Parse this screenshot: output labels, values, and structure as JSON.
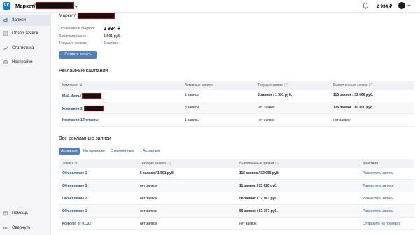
{
  "header": {
    "logo": "VK",
    "title": "Маркет/",
    "balance": "2 934 ₽",
    "icons": [
      "bell-icon",
      "avatar"
    ]
  },
  "sidebar": {
    "items": [
      {
        "label": "Записи",
        "icon": "megaphone-icon",
        "active": true
      },
      {
        "label": "Обзор заявок",
        "icon": "list-icon"
      },
      {
        "label": "Статистика",
        "icon": "chart-icon"
      },
      {
        "label": "Настройки",
        "icon": "gear-icon"
      }
    ],
    "bottom": [
      {
        "label": "Помощь",
        "icon": "help-icon"
      },
      {
        "label": "Свернуть",
        "icon": "collapse-icon"
      }
    ]
  },
  "main": {
    "breadcrumb": "Маркет/",
    "info": [
      {
        "label": "Оставшийся бюджет:",
        "value": "2 934 ₽"
      },
      {
        "label": "Заблокировано:",
        "value": "1 591 руб."
      },
      {
        "label": "Текущие заявки:",
        "value": "5 заявок"
      }
    ],
    "create_button": "Создать запись",
    "campaigns": {
      "title": "Рекламные кампании",
      "headers": [
        "Кампания ⇅",
        "Активные записи",
        "Текущие заявки",
        "Выполненные заявки"
      ],
      "header_help": "[?]",
      "rows": [
        {
          "name": "Май-Июль/",
          "active": "1 запись",
          "current": "5 заявок / 1 591 руб.",
          "done": "115 заявок / 32 066 руб."
        },
        {
          "name": "Компания 2/",
          "active": "3 записи",
          "current": "нет заявок",
          "done": "125 заявок / 80 000 руб."
        },
        {
          "name": "Компания 1/Репосты",
          "active": "1 запись",
          "current": "нет заявок",
          "done": "нет заявок"
        }
      ]
    },
    "ads": {
      "title": "Все рекламные записи",
      "tabs": [
        "Активные",
        "На проверке",
        "Отклонённые",
        "Архивные"
      ],
      "headers": [
        "Запись ⇅",
        "Текущие заявки",
        "Выполненные заявки",
        "Действия"
      ],
      "header_help": "[?]",
      "rows": [
        {
          "name": "Объявление 1",
          "current": "5 заявок / 1 591 руб.",
          "done": "115 заявок / 32 066 руб.",
          "action": "Разместить запись"
        },
        {
          "name": "Объявление 3",
          "current": "нет заявок",
          "done": "11 заявок / 15 620 руб.",
          "action": "Разместить запись"
        },
        {
          "name": "Объявление 2",
          "current": "нет заявок",
          "done": "58 заявок / 12 963 руб.",
          "action": "Разместить запись"
        },
        {
          "name": "Объявление 1",
          "current": "нет заявок",
          "done": "56 заявок / 51 397 руб.",
          "action": "Разместить запись"
        },
        {
          "name": "Конкурс от 01.02",
          "current": "нет заявок",
          "done": "нет заявок",
          "action": "Отправить на проверку"
        }
      ]
    }
  },
  "colors": {
    "accent": "#5181b8",
    "link": "#2a5885",
    "vk_blue": "#0077ff"
  }
}
